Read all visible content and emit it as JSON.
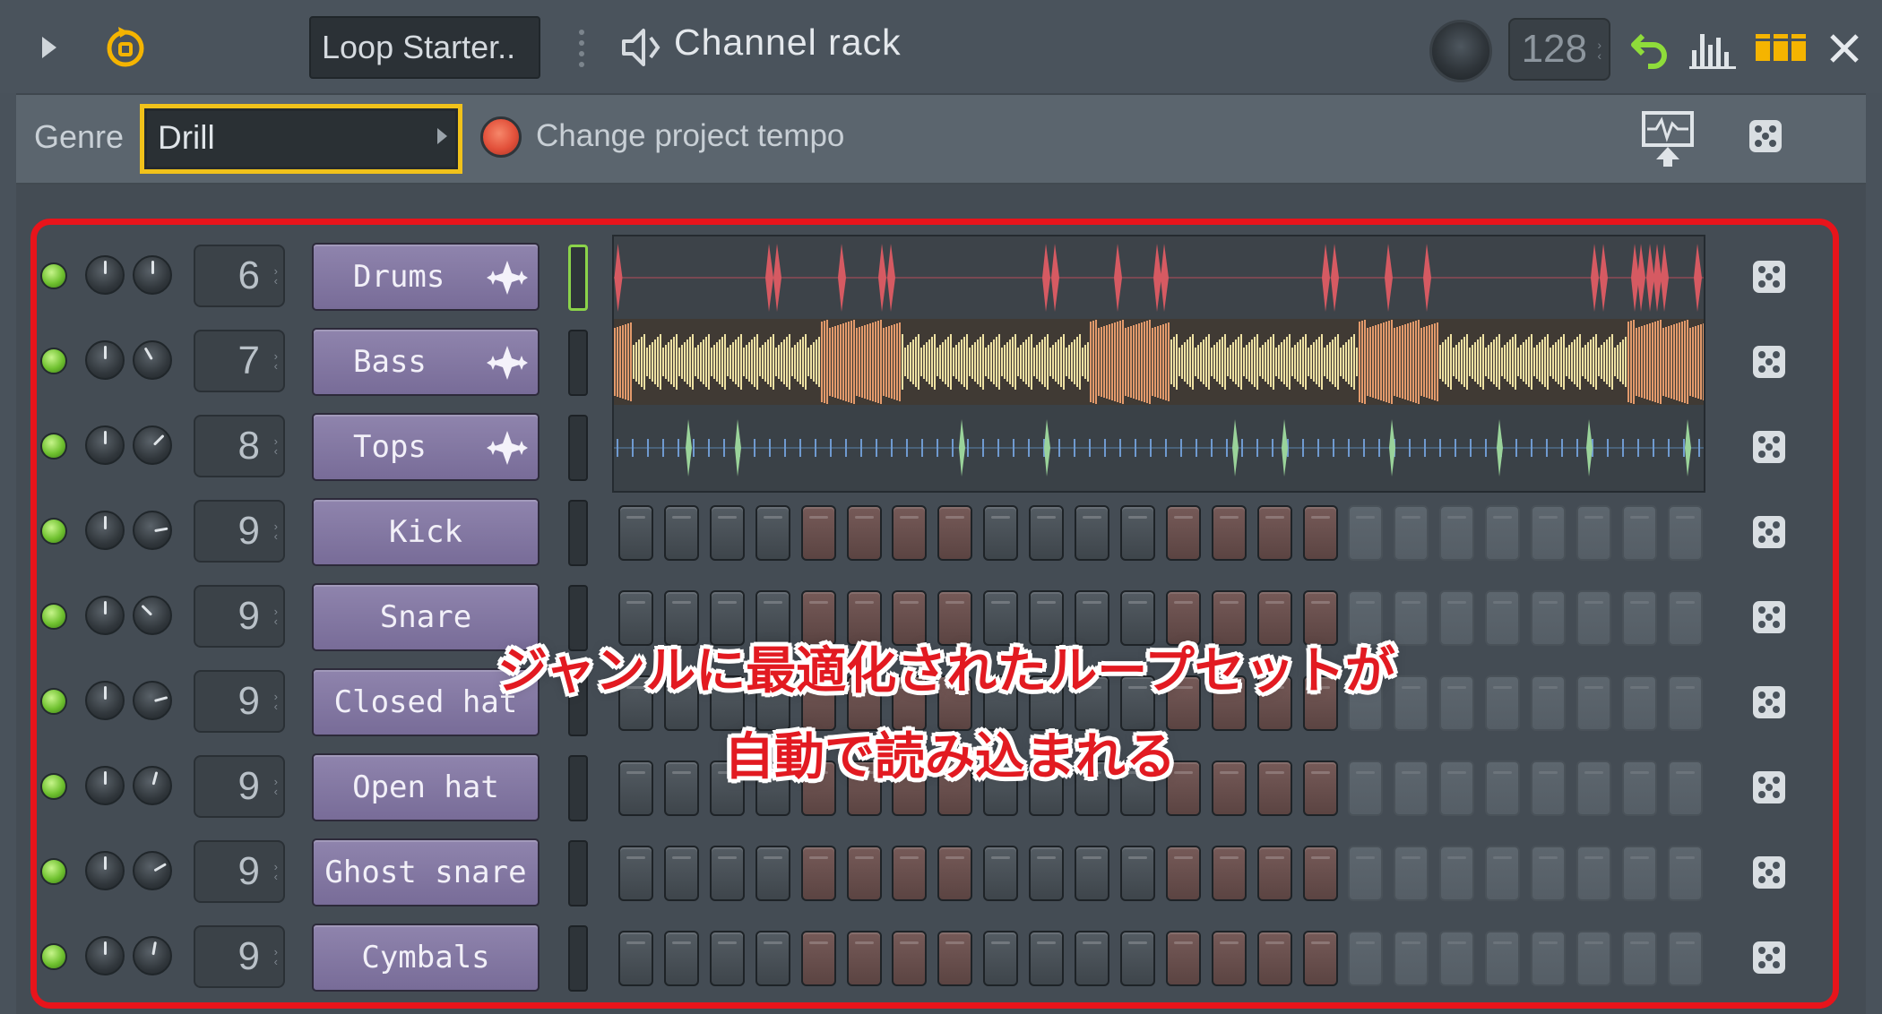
{
  "titlebar": {
    "preset_name": "Loop Starter..",
    "title": "Channel rack",
    "tempo_value": "128"
  },
  "genrebar": {
    "genre_label": "Genre",
    "genre_value": "Drill",
    "tempo_toggle_label": "Change project tempo",
    "tempo_toggle_on": true
  },
  "channels": [
    {
      "name": "Drums",
      "number": "6",
      "type": "audio",
      "pan_angle": 0
    },
    {
      "name": "Bass",
      "number": "7",
      "type": "audio",
      "pan_angle": -30
    },
    {
      "name": "Tops",
      "number": "8",
      "type": "audio",
      "pan_angle": 45
    },
    {
      "name": "Kick",
      "number": "9",
      "type": "steps",
      "pan_angle": 80
    },
    {
      "name": "Snare",
      "number": "9",
      "type": "steps",
      "pan_angle": -45
    },
    {
      "name": "Closed hat",
      "number": "9",
      "type": "steps",
      "pan_angle": 75
    },
    {
      "name": "Open hat",
      "number": "9",
      "type": "steps",
      "pan_angle": 15
    },
    {
      "name": "Ghost snare",
      "number": "9",
      "type": "steps",
      "pan_angle": 60
    },
    {
      "name": "Cymbals",
      "number": "9",
      "type": "steps",
      "pan_angle": 10
    }
  ],
  "step_pattern": [
    "dark",
    "dark",
    "dark",
    "dark",
    "red",
    "red",
    "red",
    "red",
    "dark",
    "dark",
    "dark",
    "dark",
    "red",
    "red",
    "red",
    "red",
    "light",
    "light",
    "light",
    "light",
    "light",
    "light",
    "light",
    "light"
  ],
  "overlay": {
    "line1": "ジャンルに最適化されたループセットが",
    "line2": "自動で読み込まれる"
  },
  "colors": {
    "highlight_border": "#e8141b",
    "genre_select_border": "#f1c21a",
    "channel_button": "#8579a3",
    "led_green": "#7ccd36",
    "drums_wave": "#d9535a",
    "bass_wave": "#f2e3a8",
    "tops_wave": "#9ad39a"
  }
}
